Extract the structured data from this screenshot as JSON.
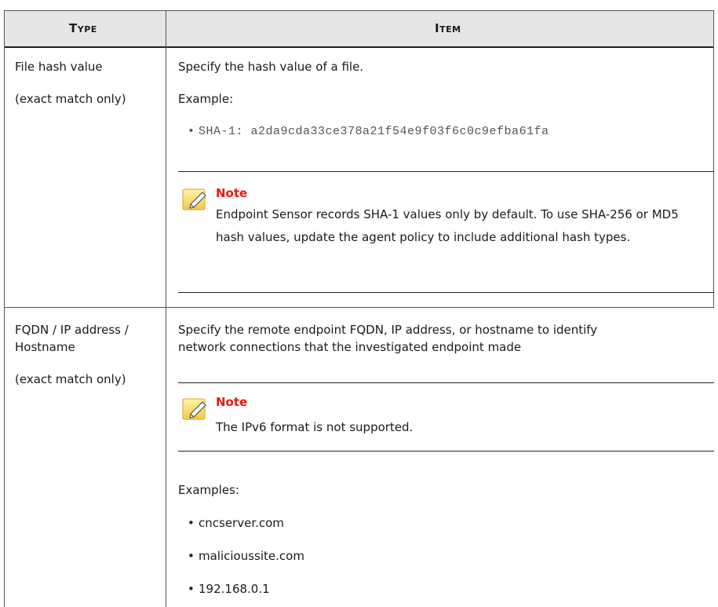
{
  "table": {
    "headers": {
      "type": "Type",
      "item": "Item"
    },
    "rows": [
      {
        "type_lines": [
          "File hash value",
          "(exact match only)"
        ],
        "item_intro": "Specify the hash value of a file.",
        "example_label": "Example:",
        "examples": [
          "SHA-1: a2da9cda33ce378a21f54e9f03f6c0c9efba61fa"
        ],
        "note_title": "Note",
        "note_body": "Endpoint Sensor records SHA-1 values only by default. To use SHA-256 or MD5 hash values, update the agent policy to include additional hash types."
      },
      {
        "type_lines": [
          "FQDN / IP address /",
          "Hostname",
          "(exact match only)"
        ],
        "item_intro_lines": [
          "Specify the remote endpoint FQDN, IP address, or hostname to identify",
          "network connections that the investigated endpoint made"
        ],
        "note_title": "Note",
        "note_body": "The IPv6 format is not supported.",
        "example_label": "Examples:",
        "examples": [
          "cncserver.com",
          "malicioussite.com",
          "192.168.0.1"
        ]
      }
    ]
  },
  "icons": {
    "note": "note-pencil-icon"
  }
}
